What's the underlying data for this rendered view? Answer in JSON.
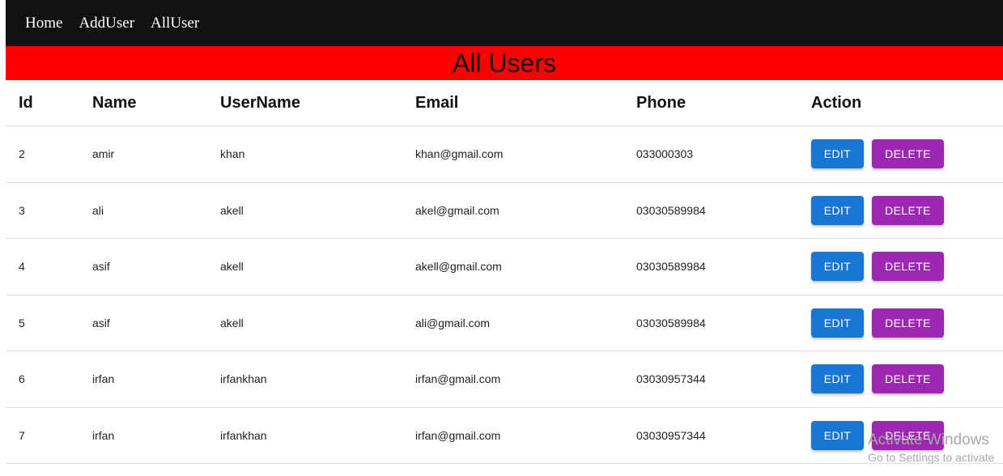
{
  "nav": {
    "items": [
      {
        "label": "Home"
      },
      {
        "label": "AddUser"
      },
      {
        "label": "AllUser"
      }
    ]
  },
  "banner": {
    "title": "All Users"
  },
  "table": {
    "headers": {
      "id": "Id",
      "name": "Name",
      "username": "UserName",
      "email": "Email",
      "phone": "Phone",
      "action": "Action"
    },
    "rows": [
      {
        "id": "2",
        "name": "amir",
        "username": "khan",
        "email": "khan@gmail.com",
        "phone": "033000303"
      },
      {
        "id": "3",
        "name": "ali",
        "username": "akell",
        "email": "akel@gmail.com",
        "phone": "03030589984"
      },
      {
        "id": "4",
        "name": "asif",
        "username": "akell",
        "email": "akell@gmail.com",
        "phone": "03030589984"
      },
      {
        "id": "5",
        "name": "asif",
        "username": "akell",
        "email": "ali@gmail.com",
        "phone": "03030589984"
      },
      {
        "id": "6",
        "name": "irfan",
        "username": "irfankhan",
        "email": "irfan@gmail.com",
        "phone": "03030957344"
      },
      {
        "id": "7",
        "name": "irfan",
        "username": "irfankhan",
        "email": "irfan@gmail.com",
        "phone": "03030957344"
      }
    ],
    "edit_label": "EDIT",
    "delete_label": "DELETE"
  },
  "colors": {
    "navbar": "#111111",
    "banner": "#ff0000",
    "edit_button": "#1976d2",
    "delete_button": "#9c27b0"
  },
  "watermark": {
    "title": "Activate Windows",
    "subtitle": "Go to Settings to activate"
  }
}
